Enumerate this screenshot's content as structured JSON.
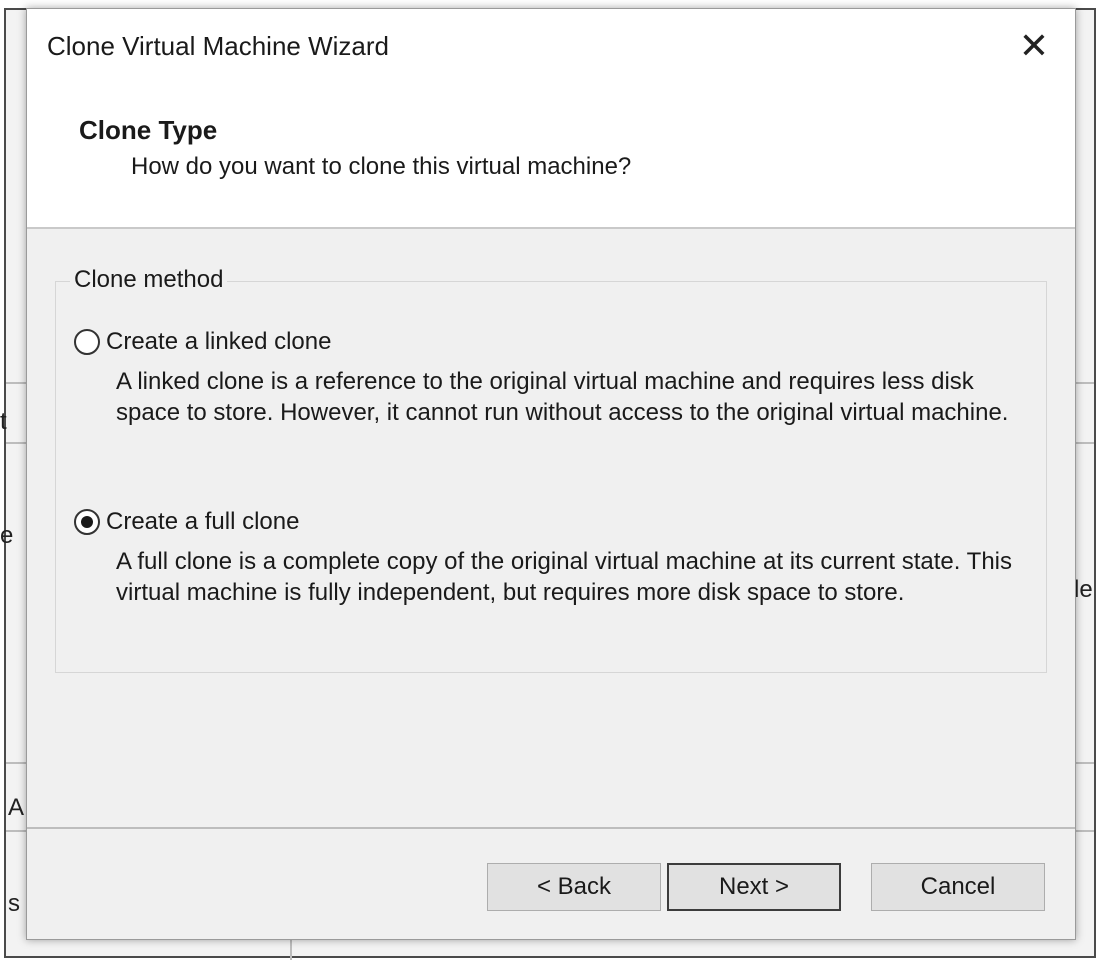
{
  "window": {
    "title": "Clone Virtual Machine Wizard",
    "close_glyph": "✕",
    "close_icon": "close-icon"
  },
  "header": {
    "title": "Clone Type",
    "subtitle": "How do you want to clone this virtual machine?"
  },
  "clone_method": {
    "legend": "Clone method",
    "options": [
      {
        "label": "Create a linked clone",
        "description": "A linked clone is a reference to the original virtual machine and requires less disk space to store. However, it cannot run without access to the original virtual machine.",
        "selected": false
      },
      {
        "label": "Create a full clone",
        "description": "A full clone is a complete copy of the original virtual machine at its current state. This virtual machine is fully independent, but requires more disk space to store.",
        "selected": true
      }
    ]
  },
  "buttons": {
    "back": "< Back",
    "next": "Next >",
    "cancel": "Cancel"
  },
  "background_fragments": {
    "left_1": "t",
    "left_2": "e",
    "left_3": "A",
    "left_4": "s",
    "right_1": "le"
  },
  "colors": {
    "dialog_bg": "#f0f0f0",
    "header_bg": "#ffffff",
    "button_bg": "#e1e1e1",
    "text": "#1a1a1a"
  }
}
